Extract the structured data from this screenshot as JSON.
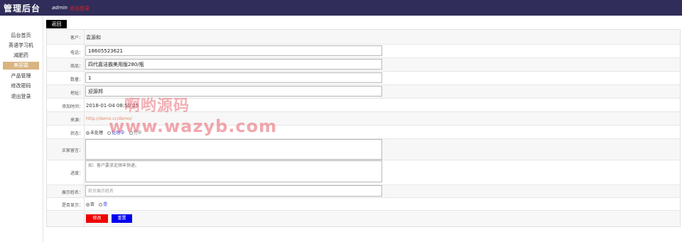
{
  "header": {
    "brand": "管理后台",
    "user": "admin",
    "logout": "退出登录"
  },
  "sidebar": {
    "items": [
      {
        "label": "后台首页"
      },
      {
        "label": "英语学习机"
      },
      {
        "label": "减肥药"
      },
      {
        "label": "美容霜"
      },
      {
        "label": "产品管理"
      },
      {
        "label": "修改密码"
      },
      {
        "label": "退出登录"
      }
    ],
    "active_index": 3
  },
  "toolbar": {
    "back_label": "返回"
  },
  "form": {
    "customer": {
      "label": "客户：",
      "value": "袁源和"
    },
    "phone": {
      "label": "电话：",
      "value": "18605523621"
    },
    "product": {
      "label": "商品：",
      "value": "四代嘉洁霸美用版280/瓶"
    },
    "quantity": {
      "label": "数量：",
      "value": "1"
    },
    "address": {
      "label": "地址：",
      "value": "迎源邦"
    },
    "added_time": {
      "label": "添加时间：",
      "value": "2018-01-04 08:50:25"
    },
    "source": {
      "label": "来源：",
      "value": "http://demo.cc/demo/"
    },
    "status": {
      "label": "状态：",
      "options": [
        "未处理",
        "处理中",
        "完毕"
      ],
      "selected": 0
    },
    "buyer_note": {
      "label": "买家留言：",
      "value": ""
    },
    "progress": {
      "label": "进度：",
      "placeholder": "如：客户要求走顺丰快递。"
    },
    "display_name": {
      "label": "展示姓名：",
      "placeholder": "前台展示姓名"
    },
    "show": {
      "label": "是否显示：",
      "options": [
        "否",
        "是"
      ],
      "selected": 0
    },
    "submit_label": "修改",
    "reset_label": "重置"
  },
  "watermark": {
    "line1": "啊哟源码",
    "line2": "www.wazyb.com"
  },
  "colors": {
    "topbar": "#302d5a",
    "active_side": "#d8b480",
    "submit": "#ee0000",
    "reset": "#0000ee"
  }
}
